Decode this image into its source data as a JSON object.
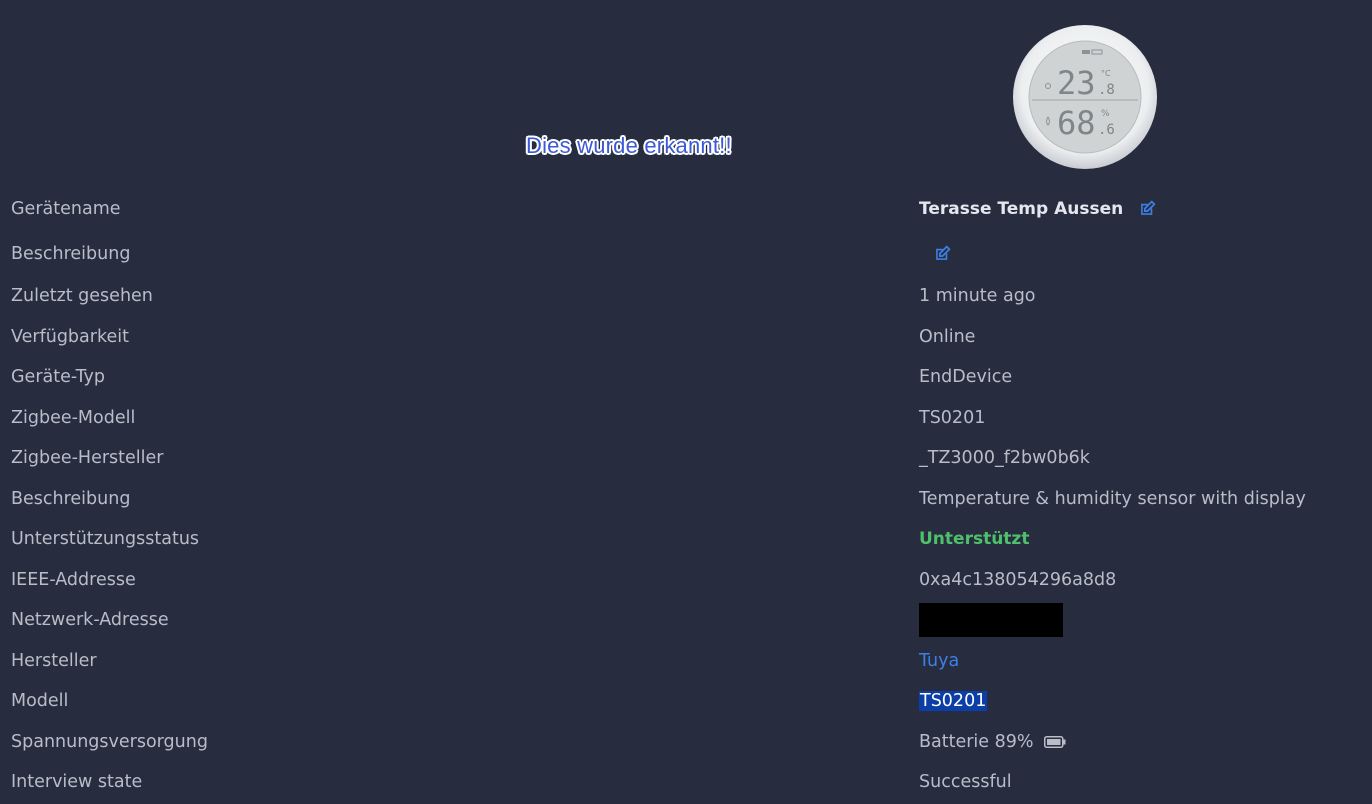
{
  "annotation": {
    "text": "Dies wurde erkannt!!"
  },
  "device_image": {
    "temperature_int": "23",
    "temperature_dec": ".8",
    "temperature_unit": "°C",
    "humidity_int": "68",
    "humidity_dec": ".6",
    "humidity_unit": "%"
  },
  "rows": [
    {
      "label": "Gerätename",
      "value": "Terasse Temp Aussen",
      "icon": "edit-icon"
    },
    {
      "label": "Beschreibung",
      "value": "",
      "icon": "edit-icon"
    },
    {
      "label": "Zuletzt gesehen",
      "value": "1 minute ago"
    },
    {
      "label": "Verfügbarkeit",
      "value": "Online"
    },
    {
      "label": "Geräte-Typ",
      "value": "EndDevice"
    },
    {
      "label": "Zigbee-Modell",
      "value": "TS0201"
    },
    {
      "label": "Zigbee-Hersteller",
      "value": "_TZ3000_f2bw0b6k"
    },
    {
      "label": "Beschreibung",
      "value": "Temperature & humidity sensor with display"
    },
    {
      "label": "Unterstützungsstatus",
      "value": "Unterstützt",
      "color": "#4ec06b"
    },
    {
      "label": "IEEE-Addresse",
      "value": "0xa4c138054296a8d8"
    },
    {
      "label": "Netzwerk-Adresse",
      "value": ""
    },
    {
      "label": "Hersteller",
      "value": "Tuya",
      "color": "#3d7fe6"
    },
    {
      "label": "Modell",
      "value": "TS0201"
    },
    {
      "label": "Spannungsversorgung",
      "value": "Batterie 89%",
      "icon": "battery-icon"
    },
    {
      "label": "Interview state",
      "value": "Successful"
    }
  ],
  "colors": {
    "background": "#272d3f",
    "text": "#b8bdc8",
    "accent_blue": "#3d7fe6",
    "supported_green": "#4ec06b",
    "selection": "#0b3ea6"
  }
}
